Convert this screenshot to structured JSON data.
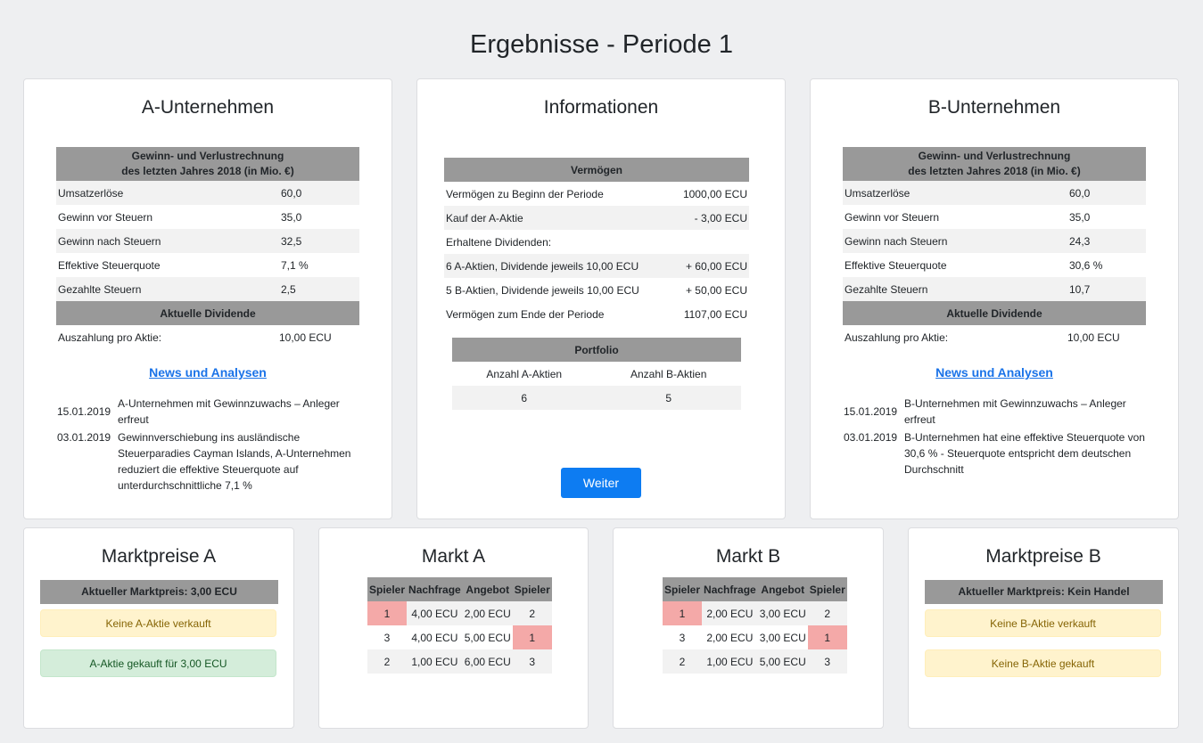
{
  "page_title": "Ergebnisse - Periode 1",
  "a_company": {
    "title": "A-Unternehmen",
    "pnl_header_line1": "Gewinn- und Verlustrechnung",
    "pnl_header_line2": "des letzten Jahres 2018 (in Mio. €)",
    "rows": [
      {
        "label": "Umsatzerlöse",
        "value": "60,0"
      },
      {
        "label": "Gewinn vor Steuern",
        "value": "35,0"
      },
      {
        "label": "Gewinn nach Steuern",
        "value": "32,5"
      },
      {
        "label": "Effektive Steuerquote",
        "value": "7,1 %"
      },
      {
        "label": "Gezahlte Steuern",
        "value": "2,5"
      }
    ],
    "dividend_header": "Aktuelle Dividende",
    "dividend_label": "Auszahlung pro Aktie:",
    "dividend_value": "10,00 ECU",
    "news_link": "News und Analysen",
    "news": [
      {
        "date": "15.01.2019",
        "text": "A-Unternehmen mit Gewinnzuwachs – Anleger erfreut"
      },
      {
        "date": "03.01.2019",
        "text": "Gewinnverschiebung ins ausländische Steuerparadies Cayman Islands, A-Unternehmen reduziert die effektive Steuerquote auf unterdurchschnittliche 7,1 %"
      }
    ]
  },
  "info": {
    "title": "Informationen",
    "assets_header": "Vermögen",
    "rows": [
      {
        "label": "Vermögen zu Beginn der Periode",
        "value": "1000,00 ECU"
      },
      {
        "label": "Kauf der A-Aktie",
        "value": "- 3,00 ECU"
      },
      {
        "label": "Erhaltene Dividenden:",
        "value": ""
      },
      {
        "label": "6 A-Aktien, Dividende jeweils 10,00 ECU",
        "value": "+ 60,00 ECU"
      },
      {
        "label": "5 B-Aktien, Dividende jeweils 10,00 ECU",
        "value": "+ 50,00 ECU"
      },
      {
        "label": "Vermögen zum Ende der Periode",
        "value": "1107,00 ECU"
      }
    ],
    "portfolio_header": "Portfolio",
    "portfolio_col_a": "Anzahl A-Aktien",
    "portfolio_col_b": "Anzahl B-Aktien",
    "portfolio_a": "6",
    "portfolio_b": "5",
    "next_button": "Weiter"
  },
  "b_company": {
    "title": "B-Unternehmen",
    "pnl_header_line1": "Gewinn- und Verlustrechnung",
    "pnl_header_line2": "des letzten Jahres 2018 (in Mio. €)",
    "rows": [
      {
        "label": "Umsatzerlöse",
        "value": "60,0"
      },
      {
        "label": "Gewinn vor Steuern",
        "value": "35,0"
      },
      {
        "label": "Gewinn nach Steuern",
        "value": "24,3"
      },
      {
        "label": "Effektive Steuerquote",
        "value": "30,6 %"
      },
      {
        "label": "Gezahlte Steuern",
        "value": "10,7"
      }
    ],
    "dividend_header": "Aktuelle Dividende",
    "dividend_label": "Auszahlung pro Aktie:",
    "dividend_value": "10,00 ECU",
    "news_link": "News und Analysen",
    "news": [
      {
        "date": "15.01.2019",
        "text": "B-Unternehmen mit Gewinnzuwachs – Anleger erfreut"
      },
      {
        "date": "03.01.2019",
        "text": "B-Unternehmen hat eine effektive Steuerquote von 30,6 % - Steuerquote entspricht dem deutschen Durchschnitt"
      }
    ]
  },
  "market_prices_a": {
    "title": "Marktpreise A",
    "current": "Aktueller Marktpreis: 3,00 ECU",
    "sold": "Keine A-Aktie verkauft",
    "bought": "A-Aktie gekauft für 3,00 ECU"
  },
  "market_a": {
    "title": "Markt A",
    "headers": [
      "Spieler",
      "Nachfrage",
      "Angebot",
      "Spieler"
    ],
    "rows": [
      [
        "1",
        "4,00 ECU",
        "2,00 ECU",
        "2"
      ],
      [
        "3",
        "4,00 ECU",
        "5,00 ECU",
        "1"
      ],
      [
        "2",
        "1,00 ECU",
        "6,00 ECU",
        "3"
      ]
    ]
  },
  "market_b": {
    "title": "Markt B",
    "headers": [
      "Spieler",
      "Nachfrage",
      "Angebot",
      "Spieler"
    ],
    "rows": [
      [
        "1",
        "2,00 ECU",
        "3,00 ECU",
        "2"
      ],
      [
        "3",
        "2,00 ECU",
        "3,00 ECU",
        "1"
      ],
      [
        "2",
        "1,00 ECU",
        "5,00 ECU",
        "3"
      ]
    ]
  },
  "market_prices_b": {
    "title": "Marktpreise B",
    "current": "Aktueller Marktpreis: Kein Handel",
    "sold": "Keine B-Aktie verkauft",
    "bought": "Keine B-Aktie gekauft"
  },
  "colors": {
    "highlight": "#f4a9a8",
    "button": "#0d7cf2",
    "header": "#999999"
  }
}
